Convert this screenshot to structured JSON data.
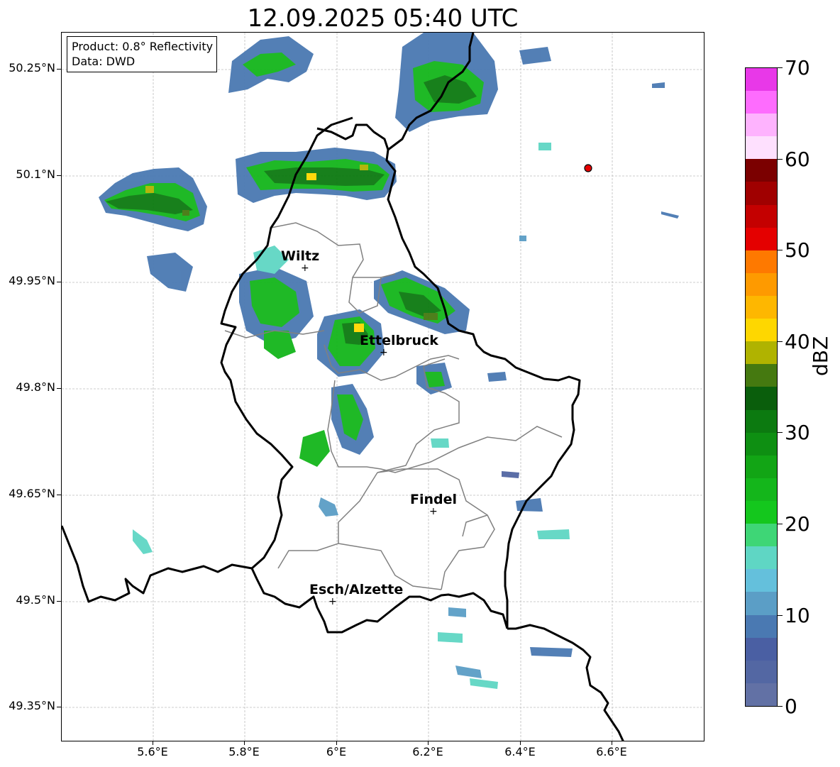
{
  "title": "12.09.2025 05:40 UTC",
  "info": {
    "product": "Product: 0.8° Reflectivity",
    "data": "Data: DWD"
  },
  "lat_ticks": [
    "50.25°N",
    "50.1°N",
    "49.95°N",
    "49.8°N",
    "49.65°N",
    "49.5°N",
    "49.35°N"
  ],
  "lon_ticks": [
    "5.6°E",
    "5.8°E",
    "6°E",
    "6.2°E",
    "6.4°E",
    "6.6°E"
  ],
  "cities": [
    {
      "name": "Wiltz",
      "lon": 5.93,
      "lat": 49.97
    },
    {
      "name": "Ettelbruck",
      "lon": 6.1,
      "lat": 49.85
    },
    {
      "name": "Findel",
      "lon": 6.21,
      "lat": 49.63
    },
    {
      "name": "Esch/Alzette",
      "lon": 5.99,
      "lat": 49.5
    }
  ],
  "radar_site_color": "#e60000",
  "colorbar": {
    "unit": "dBZ",
    "tick_labels": [
      "0",
      "10",
      "20",
      "30",
      "40",
      "50",
      "60",
      "70"
    ],
    "min": 0,
    "max": 70,
    "step": 2.5,
    "colors": [
      "#6271a5",
      "#5367a3",
      "#4a5fa3",
      "#4a79b2",
      "#5b9ec6",
      "#64c0dc",
      "#5fd6c4",
      "#3ed676",
      "#14c71d",
      "#14b61b",
      "#12a515",
      "#0e8f12",
      "#0c7a10",
      "#0a5e0c",
      "#457910",
      "#b0b300",
      "#fed700",
      "#feb700",
      "#fe9a00",
      "#fe7900",
      "#e40000",
      "#c40000",
      "#a00000",
      "#7b0000",
      "#fee0fe",
      "#feb3fe",
      "#fe6cfe",
      "#e838e8"
    ]
  }
}
